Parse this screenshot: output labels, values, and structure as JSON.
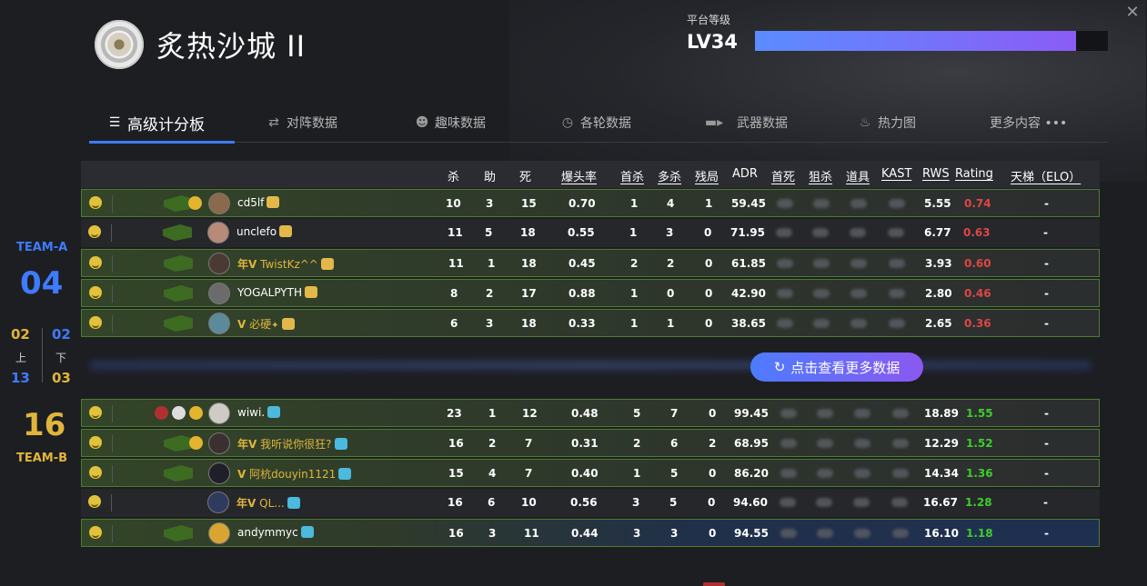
{
  "window": {
    "close_label": "✕"
  },
  "header": {
    "map_title": "炙热沙城 II",
    "level_label": "平台等级",
    "level_value": "LV34",
    "level_progress": 0.91
  },
  "tabs": [
    {
      "label": "高级计分板",
      "icon": "menu-icon",
      "active": true
    },
    {
      "label": "对阵数据",
      "icon": "versus-icon"
    },
    {
      "label": "趣味数据",
      "icon": "smile-icon"
    },
    {
      "label": "各轮数据",
      "icon": "clock-icon"
    },
    {
      "label": "武器数据",
      "icon": "rifle-icon"
    },
    {
      "label": "热力图",
      "icon": "flame-icon"
    },
    {
      "label": "更多内容 •••",
      "icon": "more-icon"
    }
  ],
  "columns": [
    "杀",
    "助",
    "死",
    "爆头率",
    "首杀",
    "多杀",
    "残局",
    "ADR",
    "首死",
    "狙杀",
    "道具",
    "KAST",
    "RWS",
    "Rating",
    "天梯（ELO）"
  ],
  "team_a": {
    "name": "TEAM-A",
    "score": "04",
    "half": {
      "first_a": "02",
      "first_b": "02",
      "first_label": "上",
      "second_label": "下",
      "second_a": "13",
      "second_b": "03"
    },
    "players": [
      {
        "name": "cd5lf",
        "vip": "",
        "kills": "10",
        "assists": "3",
        "deaths": "15",
        "hs": "0.70",
        "fk": "1",
        "mk": "4",
        "clutch": "1",
        "adr": "59.45",
        "rws": "5.55",
        "rating": "0.74",
        "elo": "-"
      },
      {
        "name": "unclefo",
        "vip": "",
        "kills": "11",
        "assists": "5",
        "deaths": "18",
        "hs": "0.55",
        "fk": "1",
        "mk": "3",
        "clutch": "0",
        "adr": "71.95",
        "rws": "6.77",
        "rating": "0.63",
        "elo": "-"
      },
      {
        "name": "TwistKz^^",
        "vip": "年V",
        "kills": "11",
        "assists": "1",
        "deaths": "18",
        "hs": "0.45",
        "fk": "2",
        "mk": "2",
        "clutch": "0",
        "adr": "61.85",
        "rws": "3.93",
        "rating": "0.60",
        "elo": "-"
      },
      {
        "name": "YOGALPYTH",
        "vip": "",
        "kills": "8",
        "assists": "2",
        "deaths": "17",
        "hs": "0.88",
        "fk": "1",
        "mk": "0",
        "clutch": "0",
        "adr": "42.90",
        "rws": "2.80",
        "rating": "0.46",
        "elo": "-"
      },
      {
        "name": "必硬",
        "vip": "V",
        "kills": "6",
        "assists": "3",
        "deaths": "18",
        "hs": "0.33",
        "fk": "1",
        "mk": "1",
        "clutch": "0",
        "adr": "38.65",
        "rws": "2.65",
        "rating": "0.36",
        "elo": "-"
      }
    ]
  },
  "team_b": {
    "name": "TEAM-B",
    "score": "16",
    "players": [
      {
        "name": "wiwi.",
        "vip": "",
        "kills": "23",
        "assists": "1",
        "deaths": "12",
        "hs": "0.48",
        "fk": "5",
        "mk": "7",
        "clutch": "0",
        "adr": "99.45",
        "rws": "18.89",
        "rating": "1.55",
        "elo": "-"
      },
      {
        "name": "我听说你很狂?",
        "vip": "年V",
        "kills": "16",
        "assists": "2",
        "deaths": "7",
        "hs": "0.31",
        "fk": "2",
        "mk": "6",
        "clutch": "2",
        "adr": "68.95",
        "rws": "12.29",
        "rating": "1.52",
        "elo": "-"
      },
      {
        "name": "阿杭douyin1121",
        "vip": "V",
        "kills": "15",
        "assists": "4",
        "deaths": "7",
        "hs": "0.40",
        "fk": "1",
        "mk": "5",
        "clutch": "0",
        "adr": "86.20",
        "rws": "14.34",
        "rating": "1.36",
        "elo": "-"
      },
      {
        "name": "QL...",
        "vip": "年V",
        "kills": "16",
        "assists": "6",
        "deaths": "10",
        "hs": "0.56",
        "fk": "3",
        "mk": "5",
        "clutch": "0",
        "adr": "94.60",
        "rws": "16.67",
        "rating": "1.28",
        "elo": "-"
      },
      {
        "name": "andymmyc",
        "vip": "",
        "kills": "16",
        "assists": "3",
        "deaths": "11",
        "hs": "0.44",
        "fk": "3",
        "mk": "3",
        "clutch": "0",
        "adr": "94.55",
        "rws": "16.10",
        "rating": "1.18",
        "elo": "-"
      }
    ]
  },
  "more_button": {
    "label": "点击查看更多数据",
    "icon": "refresh-icon"
  },
  "colors": {
    "accent": "#3e7bff",
    "team_a": "#3e7bff",
    "team_b": "#e0b53b",
    "rating_low": "#e04545",
    "rating_high": "#3fcc2d"
  }
}
